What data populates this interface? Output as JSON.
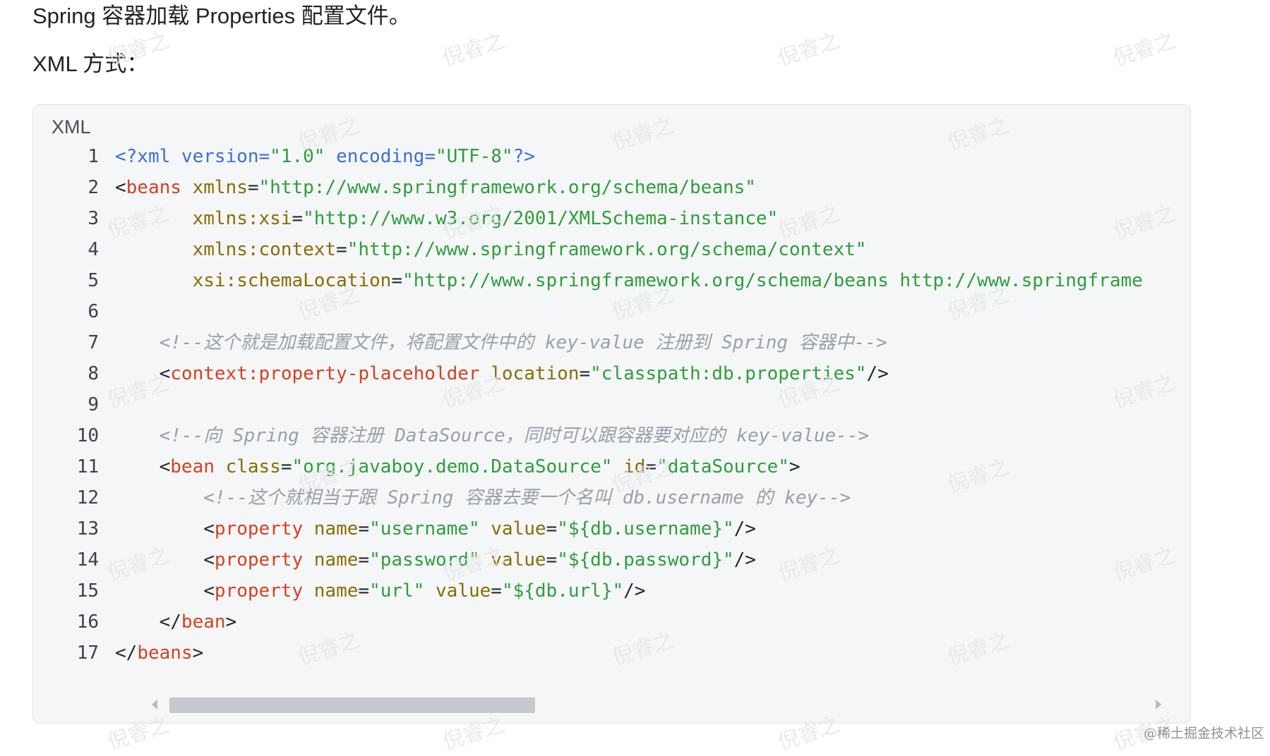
{
  "intro": {
    "line1": "Spring 容器加载 Properties 配置文件。",
    "line2": "XML 方式："
  },
  "code_block": {
    "language_label": "XML",
    "lines": [
      {
        "n": "1",
        "tokens": [
          {
            "c": "decl",
            "t": "<?xml version="
          },
          {
            "c": "str",
            "t": "\"1.0\""
          },
          {
            "c": "decl",
            "t": " encoding="
          },
          {
            "c": "str",
            "t": "\"UTF-8\""
          },
          {
            "c": "decl",
            "t": "?>"
          }
        ]
      },
      {
        "n": "2",
        "tokens": [
          {
            "c": "punct",
            "t": "<"
          },
          {
            "c": "tag",
            "t": "beans"
          },
          {
            "c": "punct",
            "t": " "
          },
          {
            "c": "attr",
            "t": "xmlns"
          },
          {
            "c": "punct",
            "t": "="
          },
          {
            "c": "str",
            "t": "\"http://www.springframework.org/schema/beans\""
          }
        ]
      },
      {
        "n": "3",
        "tokens": [
          {
            "c": "punct",
            "t": "       "
          },
          {
            "c": "attr",
            "t": "xmlns:xsi"
          },
          {
            "c": "punct",
            "t": "="
          },
          {
            "c": "str",
            "t": "\"http://www.w3.org/2001/XMLSchema-instance\""
          }
        ]
      },
      {
        "n": "4",
        "tokens": [
          {
            "c": "punct",
            "t": "       "
          },
          {
            "c": "attr",
            "t": "xmlns:context"
          },
          {
            "c": "punct",
            "t": "="
          },
          {
            "c": "str",
            "t": "\"http://www.springframework.org/schema/context\""
          }
        ]
      },
      {
        "n": "5",
        "tokens": [
          {
            "c": "punct",
            "t": "       "
          },
          {
            "c": "attr",
            "t": "xsi:schemaLocation"
          },
          {
            "c": "punct",
            "t": "="
          },
          {
            "c": "str",
            "t": "\"http://www.springframework.org/schema/beans http://www.springframe"
          }
        ]
      },
      {
        "n": "6",
        "tokens": []
      },
      {
        "n": "7",
        "tokens": [
          {
            "c": "punct",
            "t": "    "
          },
          {
            "c": "comment",
            "t": "<!--这个就是加载配置文件，将配置文件中的 key-value 注册到 Spring 容器中-->"
          }
        ]
      },
      {
        "n": "8",
        "tokens": [
          {
            "c": "punct",
            "t": "    <"
          },
          {
            "c": "tag",
            "t": "context:property-placeholder"
          },
          {
            "c": "punct",
            "t": " "
          },
          {
            "c": "attr",
            "t": "location"
          },
          {
            "c": "punct",
            "t": "="
          },
          {
            "c": "str",
            "t": "\"classpath:db.properties\""
          },
          {
            "c": "punct",
            "t": "/>"
          }
        ]
      },
      {
        "n": "9",
        "tokens": []
      },
      {
        "n": "10",
        "tokens": [
          {
            "c": "punct",
            "t": "    "
          },
          {
            "c": "comment",
            "t": "<!--向 Spring 容器注册 DataSource，同时可以跟容器要对应的 key-value-->"
          }
        ]
      },
      {
        "n": "11",
        "tokens": [
          {
            "c": "punct",
            "t": "    <"
          },
          {
            "c": "tag",
            "t": "bean"
          },
          {
            "c": "punct",
            "t": " "
          },
          {
            "c": "attr",
            "t": "class"
          },
          {
            "c": "punct",
            "t": "="
          },
          {
            "c": "str",
            "t": "\"org.javaboy.demo.DataSource\""
          },
          {
            "c": "punct",
            "t": " "
          },
          {
            "c": "attr",
            "t": "id"
          },
          {
            "c": "punct",
            "t": "="
          },
          {
            "c": "str",
            "t": "\"dataSource\""
          },
          {
            "c": "punct",
            "t": ">"
          }
        ]
      },
      {
        "n": "12",
        "tokens": [
          {
            "c": "punct",
            "t": "        "
          },
          {
            "c": "comment",
            "t": "<!--这个就相当于跟 Spring 容器去要一个名叫 db.username 的 key-->"
          }
        ]
      },
      {
        "n": "13",
        "tokens": [
          {
            "c": "punct",
            "t": "        <"
          },
          {
            "c": "tag",
            "t": "property"
          },
          {
            "c": "punct",
            "t": " "
          },
          {
            "c": "attr",
            "t": "name"
          },
          {
            "c": "punct",
            "t": "="
          },
          {
            "c": "str",
            "t": "\"username\""
          },
          {
            "c": "punct",
            "t": " "
          },
          {
            "c": "attr",
            "t": "value"
          },
          {
            "c": "punct",
            "t": "="
          },
          {
            "c": "str",
            "t": "\"${db.username}\""
          },
          {
            "c": "punct",
            "t": "/>"
          }
        ]
      },
      {
        "n": "14",
        "tokens": [
          {
            "c": "punct",
            "t": "        <"
          },
          {
            "c": "tag",
            "t": "property"
          },
          {
            "c": "punct",
            "t": " "
          },
          {
            "c": "attr",
            "t": "name"
          },
          {
            "c": "punct",
            "t": "="
          },
          {
            "c": "str",
            "t": "\"password\""
          },
          {
            "c": "punct",
            "t": " "
          },
          {
            "c": "attr",
            "t": "value"
          },
          {
            "c": "punct",
            "t": "="
          },
          {
            "c": "str",
            "t": "\"${db.password}\""
          },
          {
            "c": "punct",
            "t": "/>"
          }
        ]
      },
      {
        "n": "15",
        "tokens": [
          {
            "c": "punct",
            "t": "        <"
          },
          {
            "c": "tag",
            "t": "property"
          },
          {
            "c": "punct",
            "t": " "
          },
          {
            "c": "attr",
            "t": "name"
          },
          {
            "c": "punct",
            "t": "="
          },
          {
            "c": "str",
            "t": "\"url\""
          },
          {
            "c": "punct",
            "t": " "
          },
          {
            "c": "attr",
            "t": "value"
          },
          {
            "c": "punct",
            "t": "="
          },
          {
            "c": "str",
            "t": "\"${db.url}\""
          },
          {
            "c": "punct",
            "t": "/>"
          }
        ]
      },
      {
        "n": "16",
        "tokens": [
          {
            "c": "punct",
            "t": "    </"
          },
          {
            "c": "tag",
            "t": "bean"
          },
          {
            "c": "punct",
            "t": ">"
          }
        ]
      },
      {
        "n": "17",
        "tokens": [
          {
            "c": "punct",
            "t": "</"
          },
          {
            "c": "tag",
            "t": "beans"
          },
          {
            "c": "punct",
            "t": ">"
          }
        ]
      }
    ]
  },
  "scrollbar": {
    "position_fraction": 0.0,
    "visible_fraction": 0.36
  },
  "watermark_text": "倪睿之",
  "footer": {
    "credit": "@稀土掘金技术社区"
  },
  "colors": {
    "tag": "#d8401e",
    "attr": "#8a6d00",
    "string": "#2f9e3a",
    "declaration": "#3b6fd8",
    "comment": "#9aa0a6",
    "code_background": "#f4f6f8"
  }
}
